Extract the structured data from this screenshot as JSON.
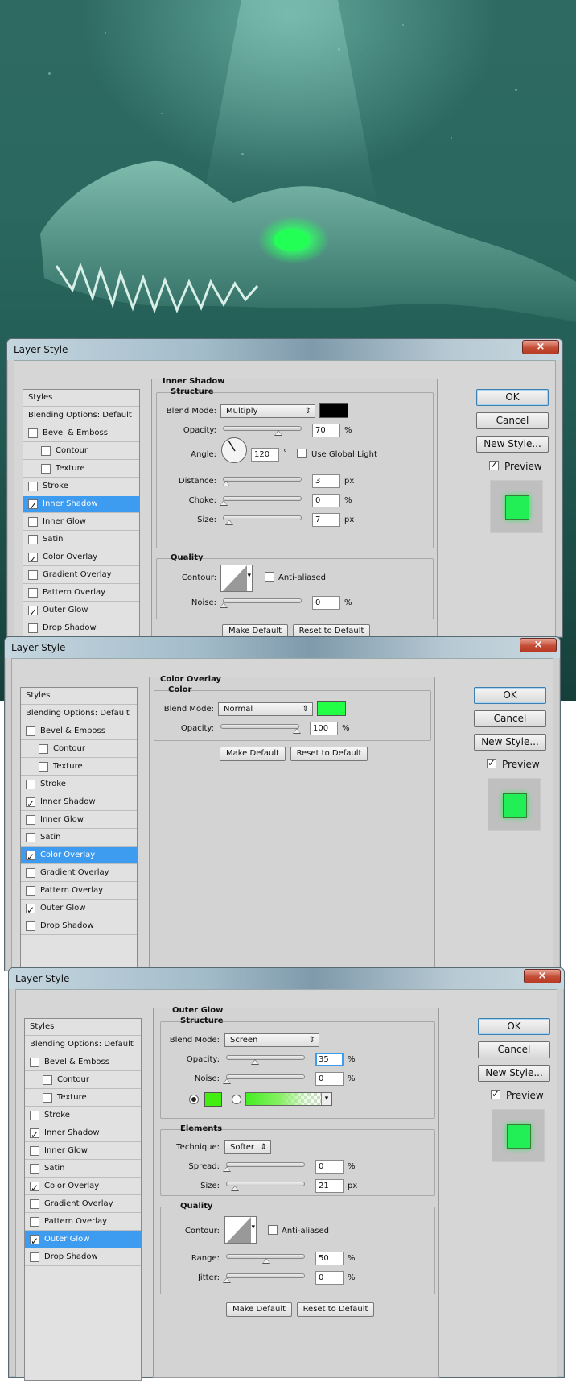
{
  "scene": {
    "bg": "#2a6860",
    "eye_color": "#22ff55"
  },
  "common": {
    "title": "Layer Style",
    "close": "×",
    "styles_header": "Styles",
    "blending": "Blending Options: Default",
    "items": [
      "Bevel & Emboss",
      "Contour",
      "Texture",
      "Stroke",
      "Inner Shadow",
      "Inner Glow",
      "Satin",
      "Color Overlay",
      "Gradient Overlay",
      "Pattern Overlay",
      "Outer Glow",
      "Drop Shadow"
    ],
    "ok": "OK",
    "cancel": "Cancel",
    "new_style": "New Style...",
    "preview": "Preview",
    "make_default": "Make Default",
    "reset_default": "Reset to Default",
    "preview_color": "#22ee55"
  },
  "d1": {
    "checks": [
      false,
      false,
      false,
      false,
      true,
      false,
      false,
      true,
      false,
      false,
      true,
      false
    ],
    "selected": 4,
    "section": "Inner Shadow",
    "structure": "Structure",
    "blend_label": "Blend Mode:",
    "blend": "Multiply",
    "swatch": "#000000",
    "opacity_label": "Opacity:",
    "opacity": "70",
    "pct": "%",
    "angle_label": "Angle:",
    "angle": "120",
    "deg": "°",
    "global_light": "Use Global Light",
    "distance_label": "Distance:",
    "distance": "3",
    "px": "px",
    "choke_label": "Choke:",
    "choke": "0",
    "size_label": "Size:",
    "size": "7",
    "quality": "Quality",
    "contour_label": "Contour:",
    "anti": "Anti-aliased",
    "noise_label": "Noise:",
    "noise": "0"
  },
  "d2": {
    "checks": [
      false,
      false,
      false,
      false,
      true,
      false,
      false,
      true,
      false,
      false,
      true,
      false
    ],
    "selected": 7,
    "section": "Color Overlay",
    "color": "Color",
    "blend_label": "Blend Mode:",
    "blend": "Normal",
    "swatch": "#22ff44",
    "opacity_label": "Opacity:",
    "opacity": "100",
    "pct": "%"
  },
  "d3": {
    "checks": [
      false,
      false,
      false,
      false,
      true,
      false,
      false,
      true,
      false,
      false,
      true,
      false
    ],
    "selected": 10,
    "section": "Outer Glow",
    "structure": "Structure",
    "blend_label": "Blend Mode:",
    "blend": "Screen",
    "opacity_label": "Opacity:",
    "opacity": "35",
    "pct": "%",
    "noise_label": "Noise:",
    "noise": "0",
    "swatch": "#44ee11",
    "elements": "Elements",
    "technique_label": "Technique:",
    "technique": "Softer",
    "spread_label": "Spread:",
    "spread": "0",
    "size_label": "Size:",
    "size": "21",
    "px": "px",
    "quality": "Quality",
    "contour_label": "Contour:",
    "anti": "Anti-aliased",
    "range_label": "Range:",
    "range": "50",
    "jitter_label": "Jitter:",
    "jitter": "0"
  }
}
